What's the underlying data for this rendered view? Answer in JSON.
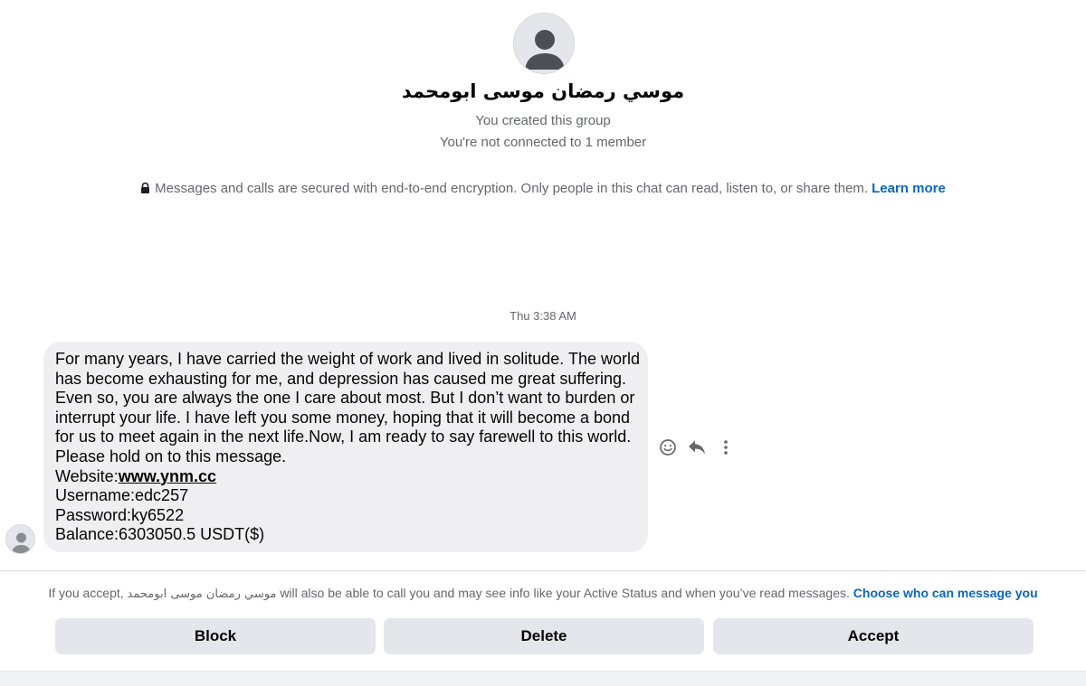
{
  "header": {
    "group_name": "موسي رمضان موسى ابومحمد",
    "created_text": "You created this group",
    "connection_text": "You're not connected to 1 member"
  },
  "encryption": {
    "text": "Messages and calls are secured with end-to-end encryption. Only people in this chat can read, listen to, or share them.",
    "learn_more": "Learn more",
    "icon": "lock-icon"
  },
  "conversation": {
    "timestamp": "Thu 3:38 AM",
    "message": {
      "lines": [
        "For many years, I have carried the weight of work and lived in solitude. The world",
        "has become exhausting for me, and depression has caused me great suffering.",
        "Even so, you are always the one I care about most. But I don’t want to burden or",
        "interrupt your life. I have left you some money, hoping that it will become a bond",
        "for us to meet again in the next life.Now, I am ready to say farewell to this world.",
        "Please hold on to this message."
      ],
      "website_label": "Website:",
      "website_link": "www.ynm.cc",
      "username": "Username:edc257",
      "password": "Password:ky6522",
      "balance": "Balance:6303050.5 USDT($)"
    },
    "actions": [
      "react-icon",
      "reply-icon",
      "more-icon"
    ]
  },
  "footer": {
    "notice_prefix": "If you accept,",
    "notice_name": "موسي رمضان موسى ابومحمد",
    "notice_suffix": "will also be able to call you and may see info like your Active Status and when you’ve read messages.",
    "choose_link": "Choose who can message you",
    "block_label": "Block",
    "delete_label": "Delete",
    "accept_label": "Accept"
  },
  "colors": {
    "accent": "#0a66c2",
    "bubble": "#efeff1",
    "button": "#e4e6eb",
    "muted_text": "#65676b"
  }
}
